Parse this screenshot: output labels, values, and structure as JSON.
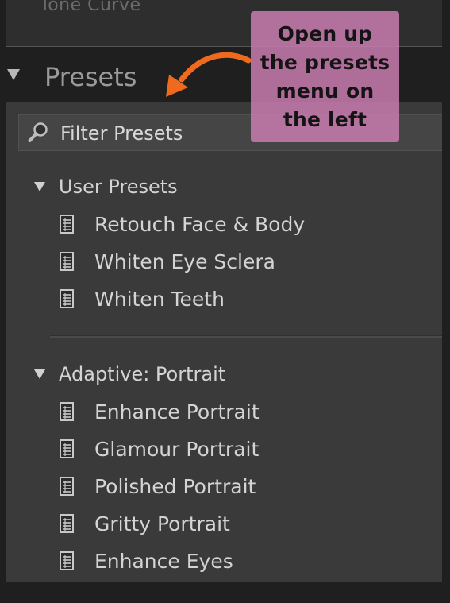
{
  "top_panel": {
    "cut_label": "Tone Curve"
  },
  "presets": {
    "title": "Presets"
  },
  "filter": {
    "placeholder": "Filter Presets"
  },
  "groups": [
    {
      "label": "User Presets",
      "items": [
        {
          "label": "Retouch Face & Body"
        },
        {
          "label": "Whiten Eye Sclera"
        },
        {
          "label": "Whiten Teeth"
        }
      ]
    },
    {
      "label": "Adaptive: Portrait",
      "items": [
        {
          "label": "Enhance Portrait"
        },
        {
          "label": "Glamour Portrait"
        },
        {
          "label": "Polished Portrait"
        },
        {
          "label": "Gritty Portrait"
        },
        {
          "label": "Enhance Eyes"
        }
      ]
    }
  ],
  "annotation": {
    "lines": [
      "Open up",
      "the presets",
      "menu on",
      "the left"
    ],
    "color": "#c97daf",
    "arrow_color": "#f06a1d"
  },
  "icons": {
    "collapse": "triangle-down-icon",
    "search": "magnifier-icon",
    "preset": "preset-document-icon",
    "arrow": "curved-arrow-icon"
  }
}
